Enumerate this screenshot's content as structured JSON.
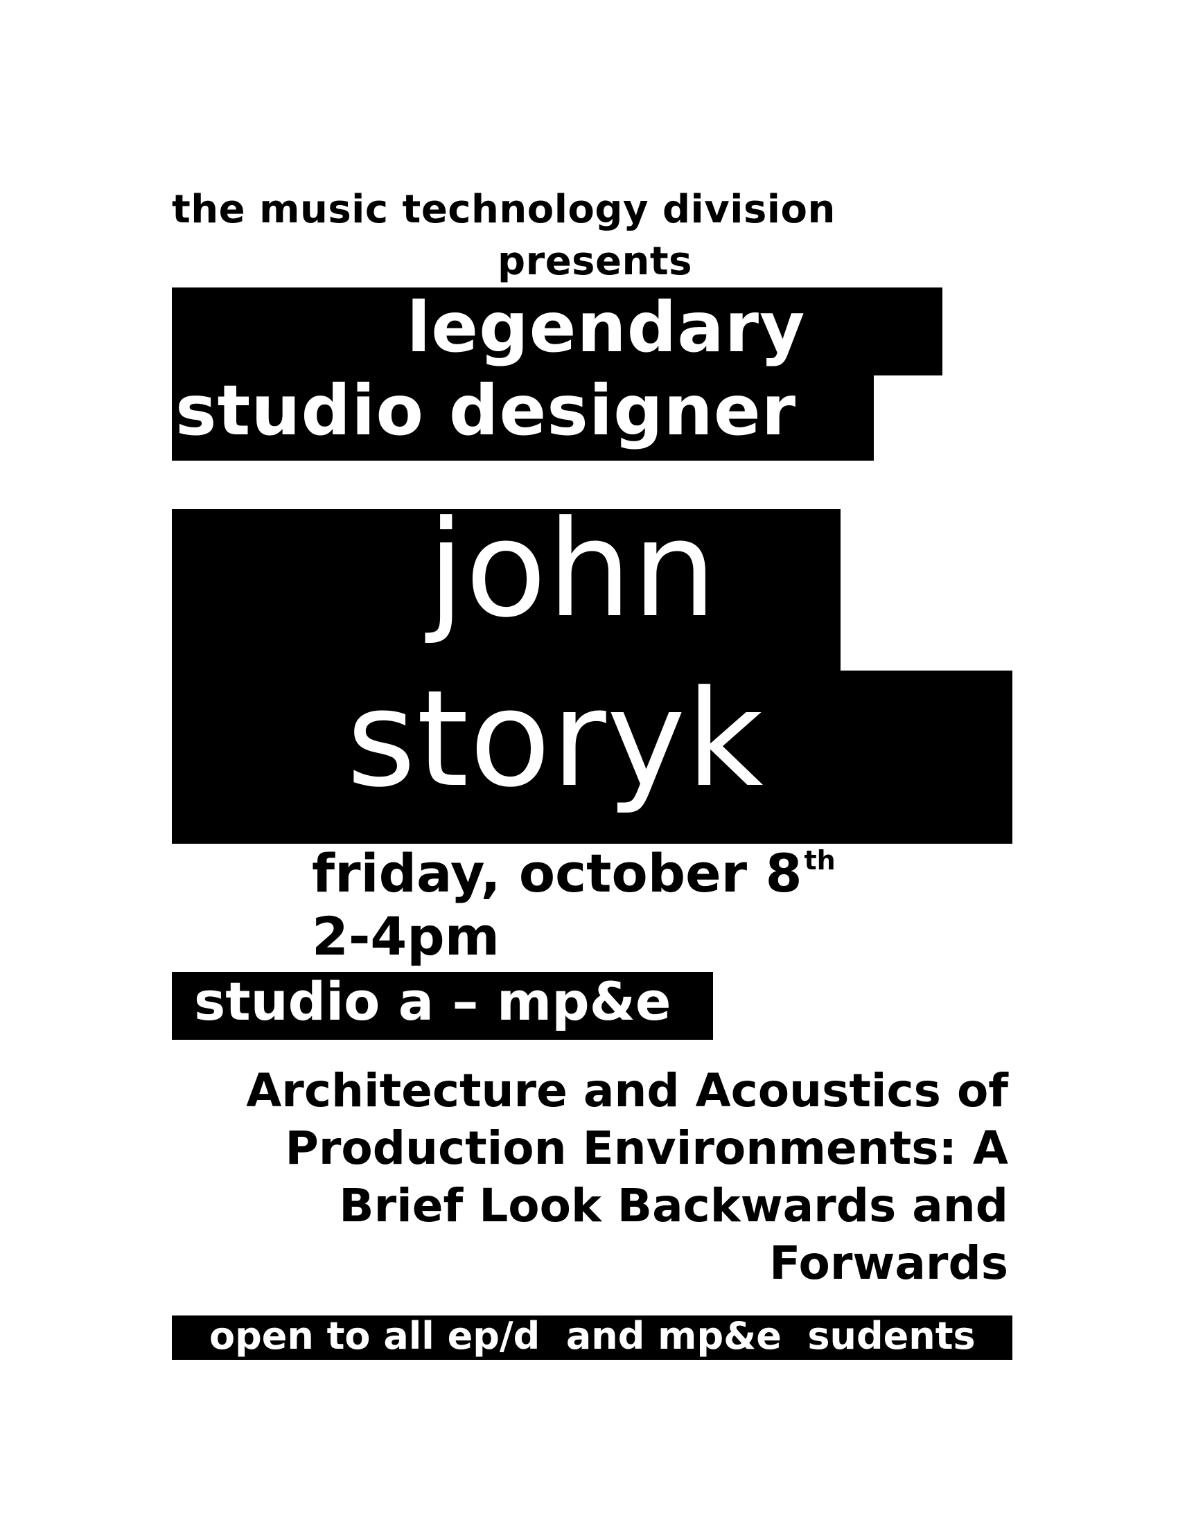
{
  "header": {
    "line1": "the music technology division",
    "line2": "presents"
  },
  "billing": {
    "line1": "legendary",
    "line2": "studio designer"
  },
  "speaker": {
    "first_name": "john",
    "last_name": "storyk"
  },
  "event": {
    "date": "friday, october 8",
    "date_suffix": "th",
    "time": "2-4pm",
    "location": "studio a – mp&e"
  },
  "talk": {
    "title_lines": [
      "Architecture and Acoustics of",
      "Production Environments: A",
      "Brief Look Backwards and",
      "Forwards"
    ]
  },
  "footer": {
    "text": "open to all ep/d  and mp&e  sudents"
  },
  "colors": {
    "ink": "#000000",
    "paper": "#ffffff"
  }
}
